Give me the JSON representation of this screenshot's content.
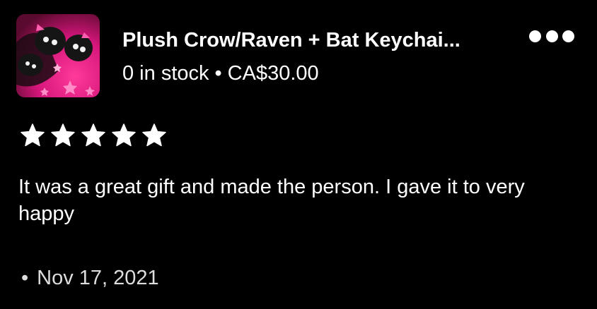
{
  "listing": {
    "title": "Plush Crow/Raven + Bat Keychai...",
    "stock": "0 in stock",
    "separator": "•",
    "price": "CA$30.00",
    "thumbnail_icon": "product-photo-plush-keychains",
    "thumbnail_colors": [
      "#e0207a",
      "#7a0a3c",
      "#ff6fb0",
      "#111111"
    ]
  },
  "more_menu": {
    "icon": "more-horizontal-icon"
  },
  "review": {
    "rating": 5,
    "max_rating": 5,
    "star_icon": "star-icon",
    "text": "It was a great gift and made the person. I gave it to very happy",
    "date_bullet": "•",
    "date": "Nov 17, 2021"
  }
}
